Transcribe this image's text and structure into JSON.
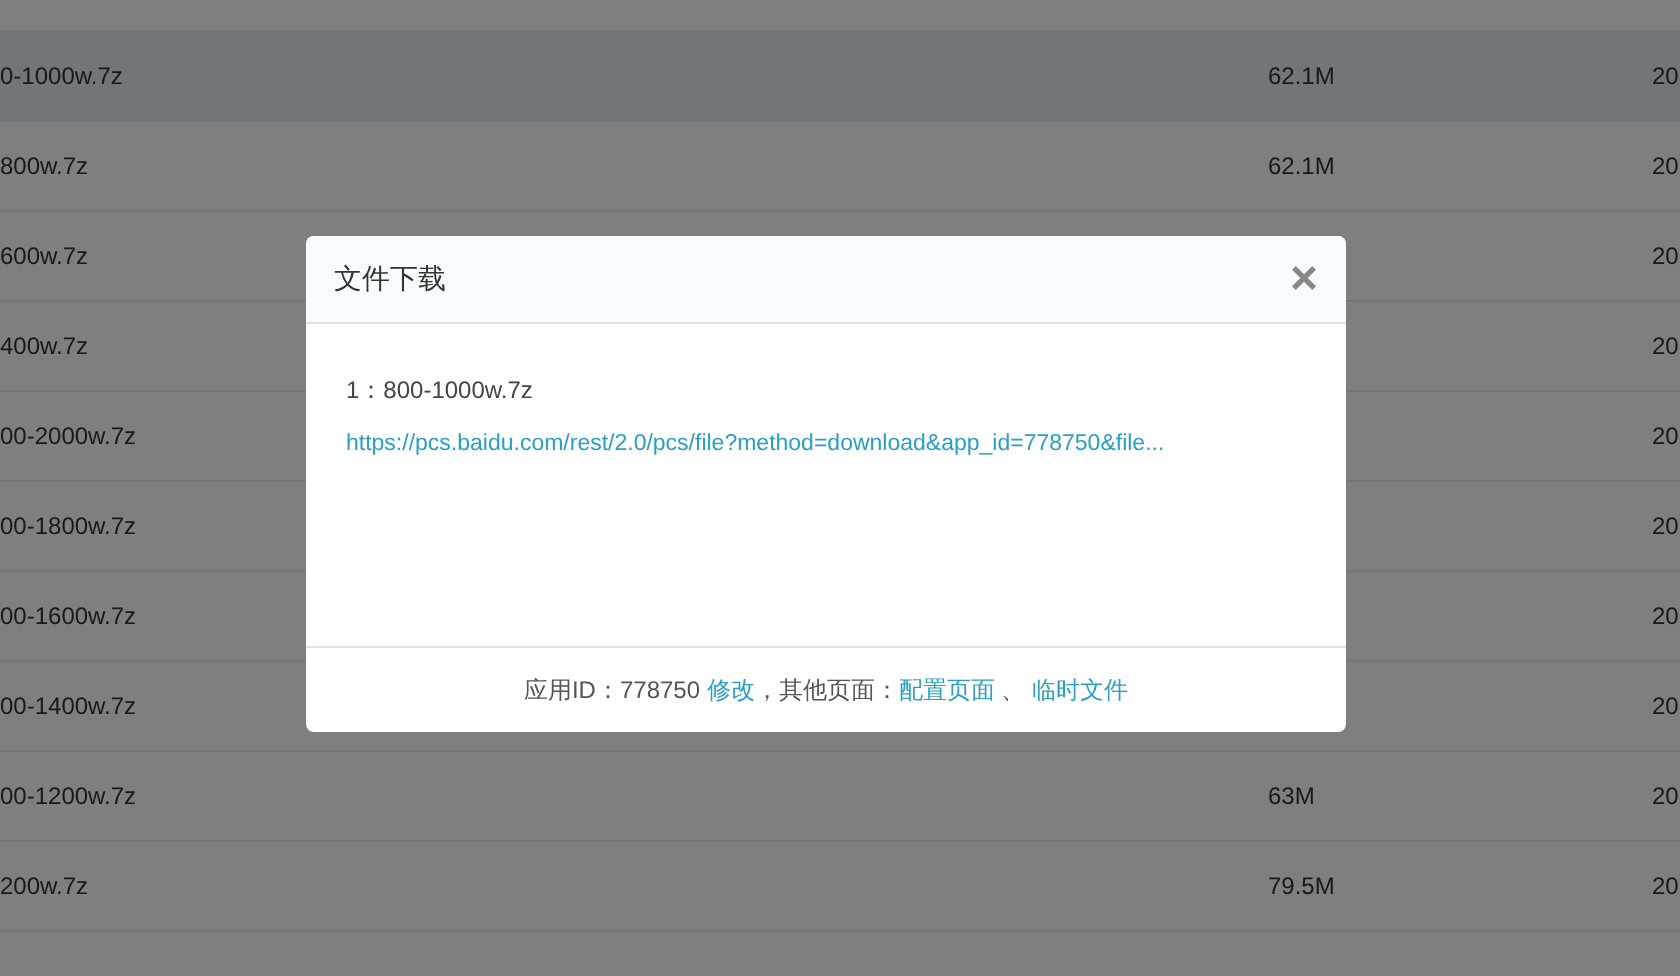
{
  "file_table": {
    "rows": [
      {
        "name": "",
        "selected": false
      },
      {
        "name": "0-1000w.7z",
        "size": "62.1M",
        "date": "20",
        "selected": true
      },
      {
        "name": "800w.7z",
        "size": "62.1M",
        "date": "20",
        "selected": false
      },
      {
        "name": "600w.7z",
        "date": "20",
        "selected": false
      },
      {
        "name": "400w.7z",
        "date": "20",
        "selected": false
      },
      {
        "name": "00-2000w.7z",
        "date": "20",
        "selected": false
      },
      {
        "name": "00-1800w.7z",
        "date": "20",
        "selected": false
      },
      {
        "name": "00-1600w.7z",
        "date": "20",
        "selected": false
      },
      {
        "name": "00-1400w.7z",
        "date": "20",
        "selected": false
      },
      {
        "name": "00-1200w.7z",
        "size": "63M",
        "date": "20",
        "selected": false
      },
      {
        "name": "200w.7z",
        "size": "79.5M",
        "date": "20",
        "selected": false
      },
      {
        "name": "",
        "selected": false
      }
    ]
  },
  "dialog": {
    "title": "文件下载",
    "close": "×",
    "files": [
      {
        "label": "1：800-1000w.7z",
        "url": "https://pcs.baidu.com/rest/2.0/pcs/file?method=download&app_id=778750&file..."
      }
    ],
    "footer": [
      {
        "kind": "text",
        "text": "应用ID：778750 "
      },
      {
        "kind": "link",
        "text": "修改"
      },
      {
        "kind": "text",
        "text": "，其他页面："
      },
      {
        "kind": "link",
        "text": "配置页面"
      },
      {
        "kind": "text",
        "text": " 、 "
      },
      {
        "kind": "link",
        "text": "临时文件"
      }
    ]
  }
}
